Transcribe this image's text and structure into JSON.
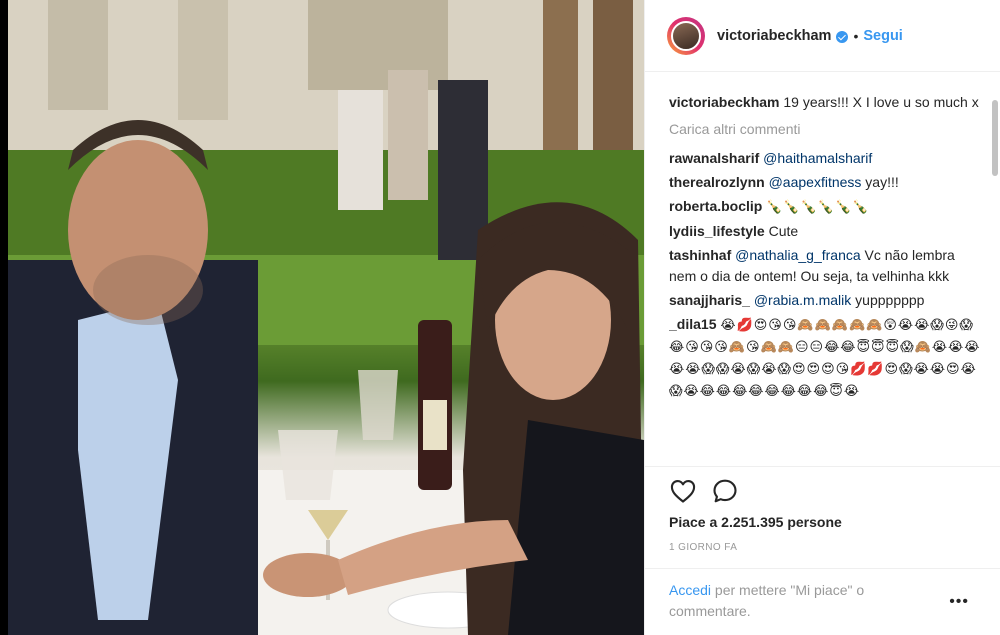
{
  "post": {
    "username": "victoriabeckham",
    "separator": "•",
    "follow_label": "Segui",
    "caption_text": "19 years!!! X I love u so much x",
    "load_more_label": "Carica altri commenti",
    "comments": [
      {
        "user": "rawanalsharif",
        "mention": "@haithamalsharif",
        "text": ""
      },
      {
        "user": "therealrozlynn",
        "mention": "@aapexfitness",
        "text": " yay!!!"
      },
      {
        "user": "roberta.boclip",
        "mention": "",
        "text": "🍾🍾🍾🍾🍾🍾"
      },
      {
        "user": "lydiis_lifestyle",
        "mention": "",
        "text": "Cute"
      },
      {
        "user": "tashinhaf",
        "mention": "@nathalia_g_franca",
        "text": " Vc não lembra nem o dia de ontem! Ou seja, ta velhinha kkk"
      },
      {
        "user": "sanajjharis_",
        "mention": "@rabia.m.malik",
        "text": " yuppppppp"
      },
      {
        "user": "_dila15",
        "mention": "",
        "text": "😭💋😍😘😘🙈🙈🙈🙈🙈😲😭😭😱😜😱😂😘😘😘🙈😘🙈🙈😑😑😂😂😇😇😇😱🙈😭😭😭😭😭😱😱😭😱😭😱😍😍😍😘💋💋😍😱😭😭😍😭😱😭😂😂😂😂😂😂😂😂😇😭"
      }
    ],
    "likes_text": "Piace a 2.251.395 persone",
    "time_text": "1 GIORNO FA",
    "login_link": "Accedi",
    "login_text": " per mettere \"Mi piace\" o commentare.",
    "more_label": "•••"
  },
  "icons": {
    "verified": "verified-badge-icon",
    "like": "heart-outline-icon",
    "comment": "speech-bubble-icon",
    "more": "more-options-icon"
  },
  "colors": {
    "accent": "#3897f0",
    "text": "#262626",
    "muted": "#999999",
    "mention": "#003569"
  }
}
